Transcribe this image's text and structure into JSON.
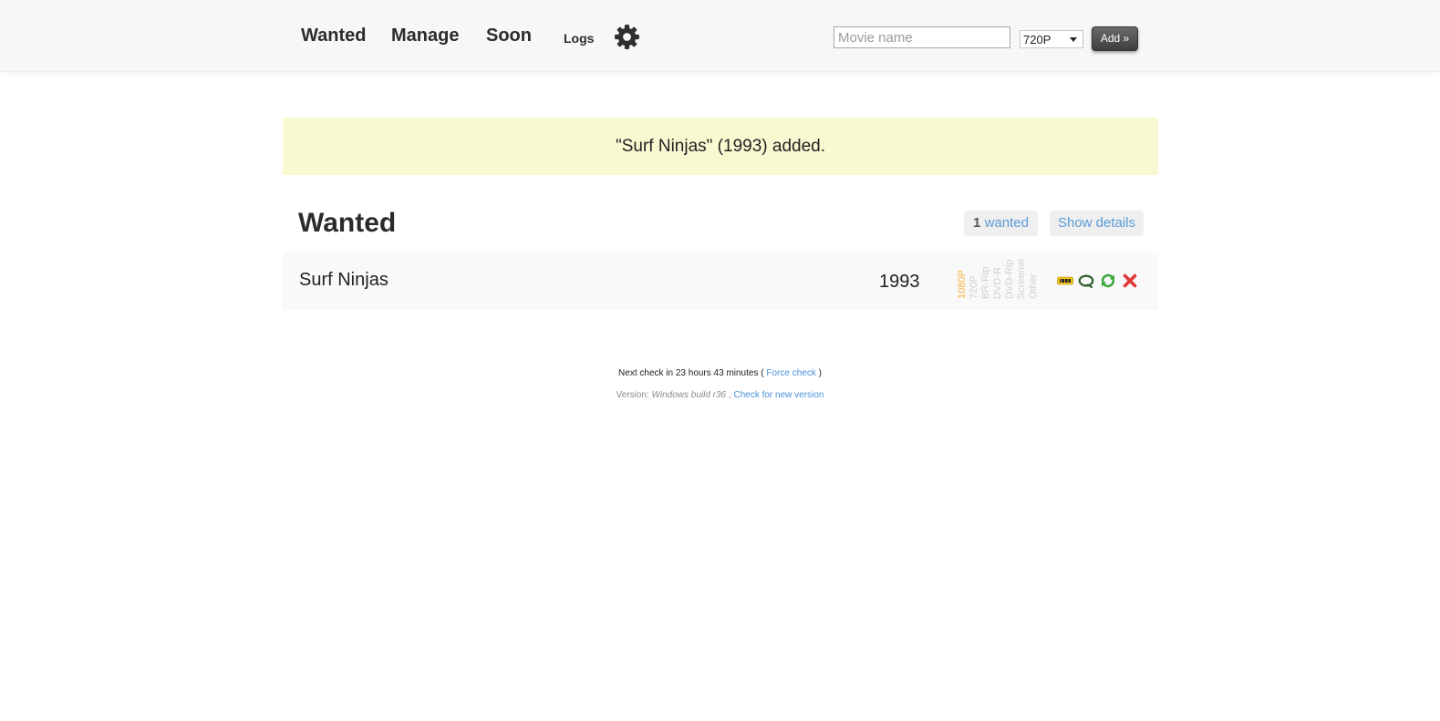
{
  "nav": {
    "wanted": "Wanted",
    "manage": "Manage",
    "soon": "Soon",
    "logs": "Logs",
    "settings_icon": "gear-icon"
  },
  "search": {
    "placeholder": "Movie name",
    "value": "",
    "quality_selected": "720P",
    "add_label": "Add »"
  },
  "notice": {
    "message": "\"Surf Ninjas\" (1993) added."
  },
  "wanted_section": {
    "title": "Wanted",
    "count": "1",
    "count_label": "wanted",
    "show_details_label": "Show details"
  },
  "movies": [
    {
      "title": "Surf Ninjas",
      "year": "1993",
      "qualities": [
        "1080P",
        "720P",
        "BR-Rip",
        "DVD-R",
        "DVD-Rip",
        "Screener",
        "Other"
      ],
      "active_quality": "1080P",
      "actions": [
        "imdb-icon",
        "search-icon",
        "refresh-icon",
        "delete-icon"
      ]
    }
  ],
  "footer": {
    "next_check_prefix": "Next check in 23 hours 43 minutes (",
    "force_check_label": "Force check",
    "next_check_suffix": ")",
    "version_prefix": "Version:",
    "version_value": "Windows build r36",
    "version_sep": ",",
    "check_version_label": "Check for new version"
  },
  "colors": {
    "notice_bg": "#f8f9d0",
    "link": "#5b9bd5",
    "active_quality": "#f5b43a",
    "inactive_quality": "#d0d0d0",
    "add_button": "#4a4a4a"
  }
}
